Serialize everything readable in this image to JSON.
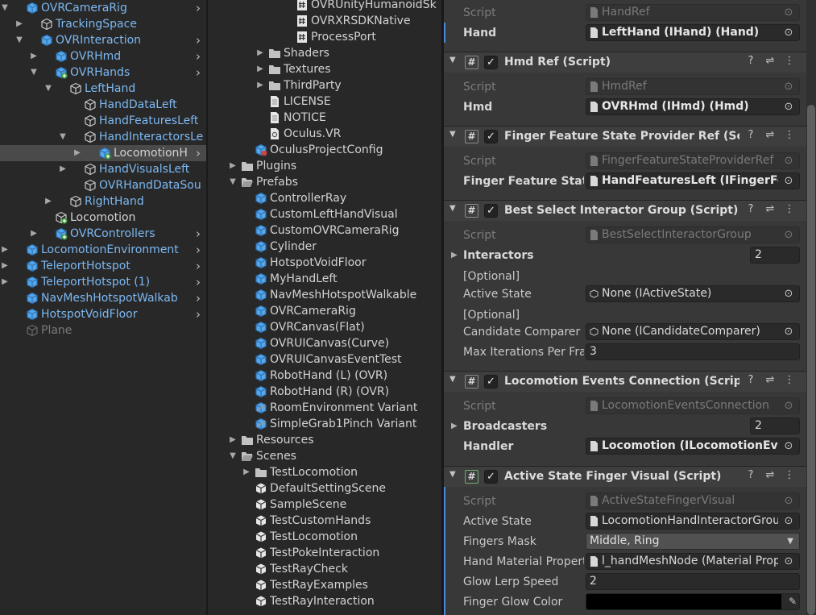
{
  "colors": {
    "accent_blue": "#7cb8f2",
    "selection": "#4a4a4a",
    "modified_bar": "#4a8ad8",
    "finger_glow_color": "#000000"
  },
  "hierarchy": {
    "rows": [
      {
        "label": "OVRCameraRig",
        "depth": 0,
        "fold": "open",
        "icon": "prefab",
        "color": "blue",
        "chevron": true
      },
      {
        "label": "TrackingSpace",
        "depth": 1,
        "fold": "closed",
        "icon": "gameobject",
        "color": "blue",
        "chevron": false
      },
      {
        "label": "OVRInteraction",
        "depth": 1,
        "fold": "open",
        "icon": "prefab",
        "color": "blue",
        "chevron": true
      },
      {
        "label": "OVRHmd",
        "depth": 2,
        "fold": "closed",
        "icon": "prefab",
        "color": "blue",
        "chevron": true
      },
      {
        "label": "OVRHands",
        "depth": 2,
        "fold": "open",
        "icon": "prefab-added",
        "color": "blue",
        "chevron": true
      },
      {
        "label": "LeftHand",
        "depth": 3,
        "fold": "open",
        "icon": "gameobject",
        "color": "blue",
        "chevron": false
      },
      {
        "label": "HandDataLeft",
        "depth": 4,
        "fold": "none",
        "icon": "gameobject",
        "color": "blue",
        "chevron": false
      },
      {
        "label": "HandFeaturesLeft",
        "depth": 4,
        "fold": "none",
        "icon": "gameobject",
        "color": "blue",
        "chevron": false
      },
      {
        "label": "HandInteractorsLe",
        "depth": 4,
        "fold": "open",
        "icon": "gameobject",
        "color": "blue",
        "chevron": false
      },
      {
        "label": "LocomotionH",
        "depth": 5,
        "fold": "closed",
        "icon": "prefab-added",
        "color": "white",
        "chevron": true,
        "selected": true
      },
      {
        "label": "HandVisualsLeft",
        "depth": 4,
        "fold": "closed",
        "icon": "gameobject",
        "color": "blue",
        "chevron": false
      },
      {
        "label": "OVRHandDataSou",
        "depth": 4,
        "fold": "none",
        "icon": "gameobject",
        "color": "blue",
        "chevron": false
      },
      {
        "label": "RightHand",
        "depth": 3,
        "fold": "closed",
        "icon": "gameobject",
        "color": "blue",
        "chevron": false
      },
      {
        "label": "Locomotion",
        "depth": 2,
        "fold": "none",
        "icon": "gameobject-added",
        "color": "white",
        "chevron": false
      },
      {
        "label": "OVRControllers",
        "depth": 2,
        "fold": "closed",
        "icon": "prefab-added",
        "color": "blue",
        "chevron": true
      },
      {
        "label": "LocomotionEnvironment",
        "depth": 0,
        "fold": "closed",
        "icon": "prefab",
        "color": "blue",
        "chevron": true
      },
      {
        "label": "TeleportHotspot",
        "depth": 0,
        "fold": "closed",
        "icon": "prefab",
        "color": "blue",
        "chevron": true
      },
      {
        "label": "TeleportHotspot (1)",
        "depth": 0,
        "fold": "closed",
        "icon": "prefab",
        "color": "blue",
        "chevron": true
      },
      {
        "label": "NavMeshHotspotWalkab",
        "depth": 0,
        "fold": "none",
        "icon": "prefab",
        "color": "blue",
        "chevron": true
      },
      {
        "label": "HotspotVoidFloor",
        "depth": 0,
        "fold": "none",
        "icon": "prefab",
        "color": "blue",
        "chevron": true
      },
      {
        "label": "Plane",
        "depth": 0,
        "fold": "none",
        "icon": "gameobject-disabled",
        "color": "gray",
        "chevron": false
      }
    ]
  },
  "project": {
    "rows": [
      {
        "label": "OVRUnityHumanoidSk",
        "depth": 5,
        "fold": "none",
        "icon": "script"
      },
      {
        "label": "OVRXRSDKNative",
        "depth": 5,
        "fold": "none",
        "icon": "script"
      },
      {
        "label": "ProcessPort",
        "depth": 5,
        "fold": "none",
        "icon": "script"
      },
      {
        "label": "Shaders",
        "depth": 3,
        "fold": "closed",
        "icon": "folder"
      },
      {
        "label": "Textures",
        "depth": 3,
        "fold": "closed",
        "icon": "folder"
      },
      {
        "label": "ThirdParty",
        "depth": 3,
        "fold": "closed",
        "icon": "folder"
      },
      {
        "label": "LICENSE",
        "depth": 3,
        "fold": "none",
        "icon": "doc"
      },
      {
        "label": "NOTICE",
        "depth": 3,
        "fold": "none",
        "icon": "doc"
      },
      {
        "label": "Oculus.VR",
        "depth": 3,
        "fold": "none",
        "icon": "asmdef"
      },
      {
        "label": "OculusProjectConfig",
        "depth": 2,
        "fold": "none",
        "icon": "config"
      },
      {
        "label": "Plugins",
        "depth": 1,
        "fold": "closed",
        "icon": "folder"
      },
      {
        "label": "Prefabs",
        "depth": 1,
        "fold": "open",
        "icon": "folder-open"
      },
      {
        "label": "ControllerRay",
        "depth": 2,
        "fold": "none",
        "icon": "prefab"
      },
      {
        "label": "CustomLeftHandVisual",
        "depth": 2,
        "fold": "none",
        "icon": "prefab"
      },
      {
        "label": "CustomOVRCameraRig",
        "depth": 2,
        "fold": "none",
        "icon": "prefab"
      },
      {
        "label": "Cylinder",
        "depth": 2,
        "fold": "none",
        "icon": "prefab"
      },
      {
        "label": "HotspotVoidFloor",
        "depth": 2,
        "fold": "none",
        "icon": "prefab"
      },
      {
        "label": "MyHandLeft",
        "depth": 2,
        "fold": "none",
        "icon": "prefab"
      },
      {
        "label": "NavMeshHotspotWalkable",
        "depth": 2,
        "fold": "none",
        "icon": "prefab"
      },
      {
        "label": "OVRCameraRig",
        "depth": 2,
        "fold": "none",
        "icon": "prefab"
      },
      {
        "label": "OVRCanvas(Flat)",
        "depth": 2,
        "fold": "none",
        "icon": "prefab"
      },
      {
        "label": "OVRUICanvas(Curve)",
        "depth": 2,
        "fold": "none",
        "icon": "prefab"
      },
      {
        "label": "OVRUICanvasEventTest",
        "depth": 2,
        "fold": "none",
        "icon": "prefab"
      },
      {
        "label": "RobotHand (L) (OVR)",
        "depth": 2,
        "fold": "none",
        "icon": "prefab"
      },
      {
        "label": "RobotHand (R) (OVR)",
        "depth": 2,
        "fold": "none",
        "icon": "prefab"
      },
      {
        "label": "RoomEnvironment Variant",
        "depth": 2,
        "fold": "none",
        "icon": "prefab-variant"
      },
      {
        "label": "SimpleGrab1Pinch Variant",
        "depth": 2,
        "fold": "none",
        "icon": "prefab-variant"
      },
      {
        "label": "Resources",
        "depth": 1,
        "fold": "closed",
        "icon": "folder"
      },
      {
        "label": "Scenes",
        "depth": 1,
        "fold": "open",
        "icon": "folder-open"
      },
      {
        "label": "TestLocomotion",
        "depth": 2,
        "fold": "closed",
        "icon": "folder"
      },
      {
        "label": "DefaultSettingScene",
        "depth": 2,
        "fold": "none",
        "icon": "scene"
      },
      {
        "label": "SampleScene",
        "depth": 2,
        "fold": "none",
        "icon": "scene"
      },
      {
        "label": "TestCustomHands",
        "depth": 2,
        "fold": "none",
        "icon": "scene"
      },
      {
        "label": "TestLocomotion",
        "depth": 2,
        "fold": "none",
        "icon": "scene"
      },
      {
        "label": "TestPokeInteraction",
        "depth": 2,
        "fold": "none",
        "icon": "scene"
      },
      {
        "label": "TestRayCheck",
        "depth": 2,
        "fold": "none",
        "icon": "scene"
      },
      {
        "label": "TestRayExamples",
        "depth": 2,
        "fold": "none",
        "icon": "scene"
      },
      {
        "label": "TestRayInteraction",
        "depth": 2,
        "fold": "none",
        "icon": "scene"
      }
    ]
  },
  "inspector": {
    "hand_ref_script": {
      "label": "Script",
      "value": "HandRef"
    },
    "hand_ref_hand": {
      "label": "Hand",
      "value": "LeftHand (IHand) (Hand)"
    },
    "hmd_ref": {
      "title": "Hmd Ref (Script)",
      "script_label": "Script",
      "script_value": "HmdRef",
      "hmd_label": "Hmd",
      "hmd_value": "OVRHmd (IHmd) (Hmd)"
    },
    "finger_feature": {
      "title": "Finger Feature State Provider Ref (Script)",
      "script_label": "Script",
      "script_value": "FingerFeatureStateProviderRef",
      "field_label": "Finger Feature State",
      "field_value": "HandFeaturesLeft (IFingerFeatureStateProvider)"
    },
    "best_select": {
      "title": "Best Select Interactor Group (Script)",
      "script_label": "Script",
      "script_value": "BestSelectInteractorGroup",
      "interactors_label": "Interactors",
      "interactors_count": "2",
      "optional1": "[Optional]",
      "active_state_label": "Active State",
      "active_state_value": "None (IActiveState)",
      "optional2": "[Optional]",
      "candidate_label": "Candidate Comparer",
      "candidate_value": "None (ICandidateComparer)",
      "max_iter_label": "Max Iterations Per Frame",
      "max_iter_value": "3"
    },
    "loco_events": {
      "title": "Locomotion Events Connection (Script)",
      "script_label": "Script",
      "script_value": "LocomotionEventsConnection",
      "broadcasters_label": "Broadcasters",
      "broadcasters_count": "2",
      "handler_label": "Handler",
      "handler_value": "Locomotion (ILocomotionEventHandler)"
    },
    "finger_visual": {
      "title": "Active State Finger Visual (Script)",
      "script_label": "Script",
      "script_value": "ActiveStateFingerVisual",
      "active_state_label": "Active State",
      "active_state_value": "LocomotionHandInteractorGroup",
      "fingers_mask_label": "Fingers Mask",
      "fingers_mask_value": "Middle, Ring",
      "hand_mat_label": "Hand Material Property Block",
      "hand_mat_value": "l_handMeshNode (Material Property Block Editor)",
      "glow_lerp_label": "Glow Lerp Speed",
      "glow_lerp_value": "2",
      "glow_color_label": "Finger Glow Color"
    }
  }
}
